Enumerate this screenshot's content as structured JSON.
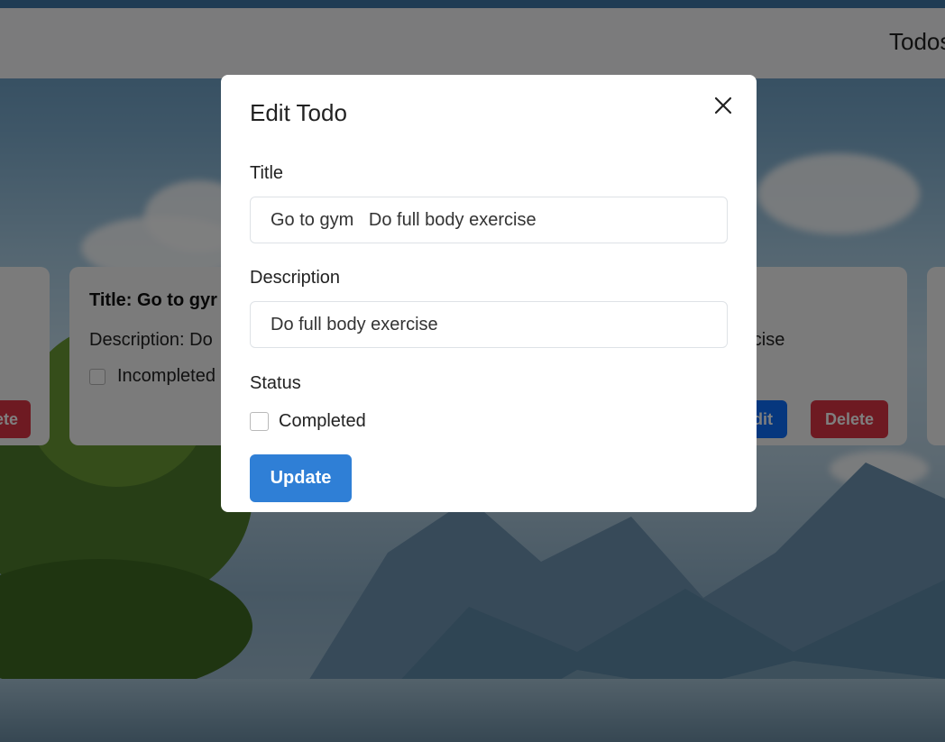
{
  "navbar": {
    "brand": "Todos"
  },
  "cards": {
    "left": {
      "delete_label": "ete"
    },
    "middle": {
      "title": "Title: Go to gyr",
      "description": "Description: Do",
      "status_label": "Incompleted"
    },
    "right": {
      "description_fragment": "ercise",
      "edit_label": "dit",
      "delete_label": "Delete"
    }
  },
  "modal": {
    "title": "Edit Todo",
    "title_label": "Title",
    "title_value": "Go to gym   Do full body exercise",
    "description_label": "Description",
    "description_value": "Do full body exercise",
    "status_label": "Status",
    "completed_label": "Completed",
    "completed_checked": false,
    "update_label": "Update"
  },
  "colors": {
    "primary": "#2f7fd6",
    "danger": "#dc3545",
    "backdrop": "rgba(0,0,0,0.5)"
  }
}
